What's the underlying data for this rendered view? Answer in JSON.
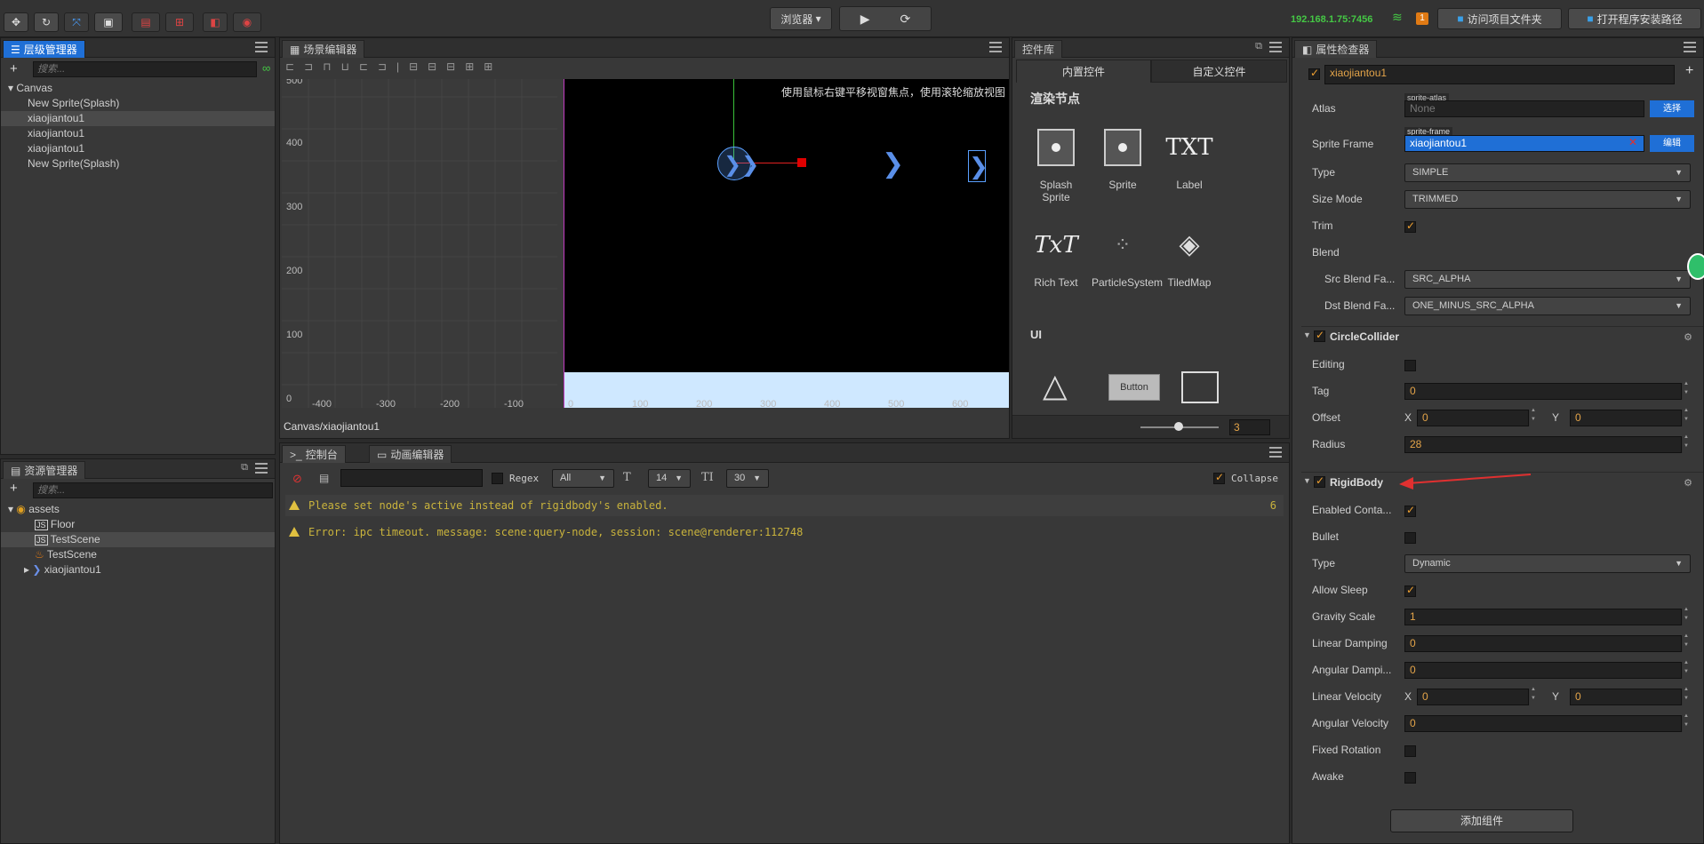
{
  "toolbar": {
    "browser_label": "浏览器",
    "ip": "192.168.1.75:7456",
    "notif_count": "1",
    "open_project_folder": "访问项目文件夹",
    "open_install_path": "打开程序安装路径"
  },
  "hierarchy": {
    "tab": "层级管理器",
    "search_placeholder": "搜索...",
    "items": [
      "Canvas",
      "New Sprite(Splash)",
      "xiaojiantou1",
      "xiaojiantou1",
      "xiaojiantou1",
      "New Sprite(Splash)"
    ]
  },
  "scene": {
    "tab": "场景编辑器",
    "hint": "使用鼠标右键平移视窗焦点，使用滚轮缩放视图",
    "y_ticks": [
      "500",
      "400",
      "300",
      "200",
      "100",
      "0"
    ],
    "x_ticks": [
      "-400",
      "-300",
      "-200",
      "-100",
      "0",
      "100",
      "200",
      "300",
      "400",
      "500",
      "600"
    ],
    "breadcrumb": "Canvas/xiaojiantou1"
  },
  "controls": {
    "tab": "控件库",
    "tab_builtin": "内置控件",
    "tab_custom": "自定义控件",
    "section_render": "渲染节点",
    "section_ui": "UI",
    "items": [
      "Splash Sprite",
      "Sprite",
      "Label",
      "Rich Text",
      "ParticleSystem",
      "TiledMap"
    ],
    "button_label": "Button",
    "zoom_value": "3"
  },
  "assets": {
    "tab": "资源管理器",
    "search_placeholder": "搜索...",
    "items": [
      "assets",
      "Floor",
      "TestScene",
      "TestScene",
      "xiaojiantou1"
    ]
  },
  "console": {
    "tab_console": "控制台",
    "tab_anim": "动画编辑器",
    "regex_label": "Regex",
    "filter_value": "All",
    "font_size": "14",
    "line_height": "30",
    "collapse_label": "Collapse",
    "lines": [
      {
        "text": "Please set node's active instead of rigidbody's enabled.",
        "count": "6"
      },
      {
        "text": "Error: ipc timeout. message: scene:query-node, session: scene@renderer:112748",
        "count": ""
      }
    ]
  },
  "inspector": {
    "tab": "属性检查器",
    "node_name": "xiaojiantou1",
    "atlas_label": "Atlas",
    "atlas_tag": "sprite-atlas",
    "atlas_value": "None",
    "atlas_btn": "选择",
    "sprite_frame_label": "Sprite Frame",
    "sprite_frame_tag": "sprite-frame",
    "sprite_frame_value": "xiaojiantou1",
    "sprite_frame_btn": "编辑",
    "type_label": "Type",
    "type_value": "SIMPLE",
    "size_mode_label": "Size Mode",
    "size_mode_value": "TRIMMED",
    "trim_label": "Trim",
    "blend_label": "Blend",
    "src_blend_label": "Src Blend Fa...",
    "src_blend_value": "SRC_ALPHA",
    "dst_blend_label": "Dst Blend Fa...",
    "dst_blend_value": "ONE_MINUS_SRC_ALPHA",
    "circle_title": "CircleCollider",
    "editing_label": "Editing",
    "tag_label": "Tag",
    "tag_value": "0",
    "offset_label": "Offset",
    "offset_x": "0",
    "offset_y": "0",
    "radius_label": "Radius",
    "radius_value": "28",
    "rigid_title": "RigidBody",
    "enabled_contact_label": "Enabled Conta...",
    "bullet_label": "Bullet",
    "rb_type_label": "Type",
    "rb_type_value": "Dynamic",
    "allow_sleep_label": "Allow Sleep",
    "gravity_label": "Gravity Scale",
    "gravity_value": "1",
    "linear_damping_label": "Linear Damping",
    "linear_damping_value": "0",
    "angular_damping_label": "Angular Dampi...",
    "angular_damping_value": "0",
    "linear_velocity_label": "Linear Velocity",
    "lv_x": "0",
    "lv_y": "0",
    "angular_velocity_label": "Angular Velocity",
    "angular_velocity_value": "0",
    "fixed_rotation_label": "Fixed Rotation",
    "awake_label": "Awake",
    "add_component": "添加组件",
    "x_label": "X",
    "y_label": "Y"
  },
  "colors": {
    "accent": "#1f6fd6",
    "warning_text": "#c9b33c",
    "number_text": "#e4a449",
    "ip_text": "#45c845"
  }
}
